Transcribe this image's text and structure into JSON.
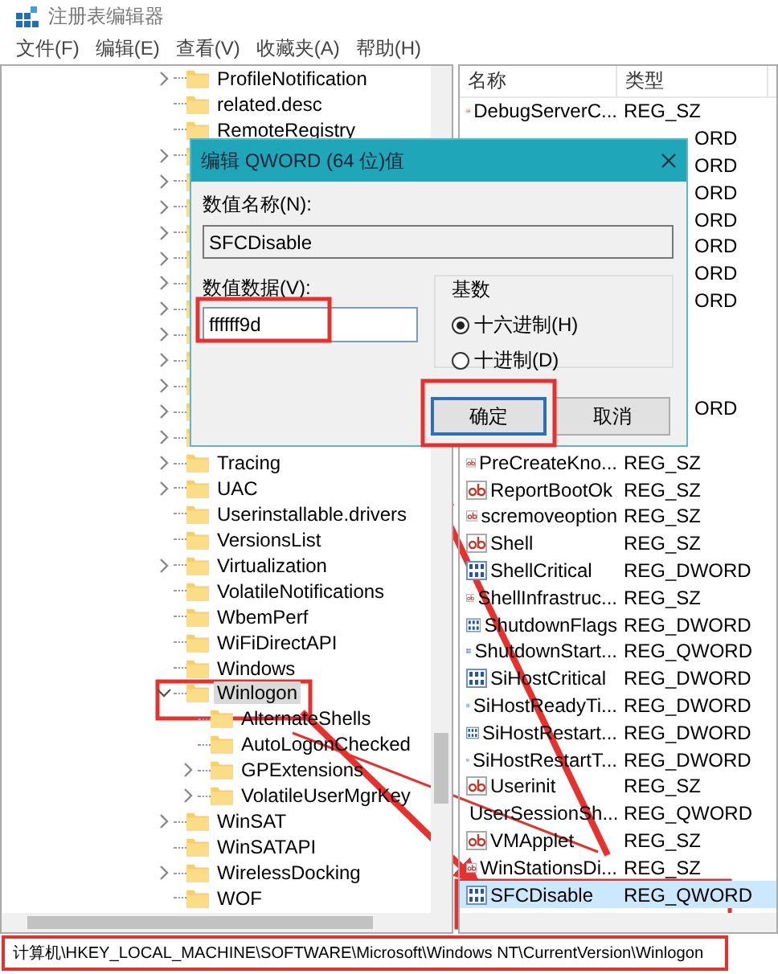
{
  "window": {
    "title": "注册表编辑器"
  },
  "menu": [
    "文件(F)",
    "编辑(E)",
    "查看(V)",
    "收藏夹(A)",
    "帮助(H)"
  ],
  "tree": [
    {
      "label": "ProfileNotification",
      "kind": "branch",
      "selected": false
    },
    {
      "label": "related.desc",
      "kind": "leaf",
      "selected": false
    },
    {
      "label": "RemoteRegistry",
      "kind": "leaf",
      "selected": false
    },
    {
      "kind": "branch"
    },
    {
      "kind": "branch"
    },
    {
      "kind": "branch"
    },
    {
      "kind": "branch"
    },
    {
      "kind": "branch"
    },
    {
      "kind": "branch"
    },
    {
      "kind": "branch"
    },
    {
      "kind": "branch"
    },
    {
      "kind": "branch"
    },
    {
      "kind": "branch"
    },
    {
      "kind": "branch"
    },
    {
      "kind": "branch"
    },
    {
      "label": "Tracing",
      "kind": "branch",
      "selected": false
    },
    {
      "label": "UAC",
      "kind": "branch",
      "selected": false
    },
    {
      "label": "Userinstallable.drivers",
      "kind": "leaf",
      "selected": false
    },
    {
      "label": "VersionsList",
      "kind": "leaf",
      "selected": false
    },
    {
      "label": "Virtualization",
      "kind": "branch",
      "selected": false
    },
    {
      "label": "VolatileNotifications",
      "kind": "leaf",
      "selected": false
    },
    {
      "label": "WbemPerf",
      "kind": "leaf",
      "selected": false
    },
    {
      "label": "WiFiDirectAPI",
      "kind": "leaf",
      "selected": false
    },
    {
      "label": "Windows",
      "kind": "leaf",
      "selected": false
    },
    {
      "label": "Winlogon",
      "kind": "open",
      "selected": true,
      "children": [
        {
          "label": "AlternateShells",
          "kind": "leaf",
          "selected": false
        },
        {
          "label": "AutoLogonChecked",
          "kind": "leaf",
          "selected": false
        },
        {
          "label": "GPExtensions",
          "kind": "branch",
          "selected": false
        },
        {
          "label": "VolatileUserMgrKey",
          "kind": "branch",
          "selected": false
        }
      ]
    },
    {
      "label": "WinSAT",
      "kind": "branch",
      "selected": false
    },
    {
      "label": "WinSATAPI",
      "kind": "leaf",
      "selected": false
    },
    {
      "label": "WirelessDocking",
      "kind": "branch",
      "selected": false
    },
    {
      "label": "WOF",
      "kind": "leaf",
      "selected": false
    }
  ],
  "list": {
    "columns": [
      "名称",
      "类型"
    ],
    "rows": [
      {
        "kind": "string",
        "name": "DebugServerC...",
        "type": "REG_SZ",
        "selected": false
      },
      {
        "kind": "covered",
        "type": "ORD"
      },
      {
        "kind": "covered",
        "type": "ORD"
      },
      {
        "kind": "covered",
        "type": "ORD"
      },
      {
        "kind": "covered",
        "type": "ORD"
      },
      {
        "kind": "covered",
        "type": "ORD"
      },
      {
        "kind": "covered",
        "type": "ORD"
      },
      {
        "kind": "covered",
        "type": "ORD"
      },
      {
        "kind": "covered"
      },
      {
        "kind": "covered"
      },
      {
        "kind": "covered"
      },
      {
        "kind": "covered",
        "type": "ORD"
      },
      {
        "kind": "covered"
      },
      {
        "kind": "string",
        "name": "PreCreateKno...",
        "type": "REG_SZ",
        "selected": false
      },
      {
        "kind": "string",
        "name": "ReportBootOk",
        "type": "REG_SZ",
        "selected": false
      },
      {
        "kind": "string",
        "name": "scremoveoption",
        "type": "REG_SZ",
        "selected": false
      },
      {
        "kind": "string",
        "name": "Shell",
        "type": "REG_SZ",
        "selected": false
      },
      {
        "kind": "binary",
        "name": "ShellCritical",
        "type": "REG_DWORD",
        "selected": false
      },
      {
        "kind": "string",
        "name": "ShellInfrastruc...",
        "type": "REG_SZ",
        "selected": false
      },
      {
        "kind": "binary",
        "name": "ShutdownFlags",
        "type": "REG_DWORD",
        "selected": false
      },
      {
        "kind": "binary",
        "name": "ShutdownStart...",
        "type": "REG_QWORD",
        "selected": false
      },
      {
        "kind": "binary",
        "name": "SiHostCritical",
        "type": "REG_DWORD",
        "selected": false
      },
      {
        "kind": "binary",
        "name": "SiHostReadyTi...",
        "type": "REG_DWORD",
        "selected": false
      },
      {
        "kind": "binary",
        "name": "SiHostRestart...",
        "type": "REG_DWORD",
        "selected": false
      },
      {
        "kind": "binary",
        "name": "SiHostRestartT...",
        "type": "REG_DWORD",
        "selected": false
      },
      {
        "kind": "string",
        "name": "Userinit",
        "type": "REG_SZ",
        "selected": false
      },
      {
        "kind": "binary",
        "name": "UserSessionSh...",
        "type": "REG_QWORD",
        "selected": false
      },
      {
        "kind": "string",
        "name": "VMApplet",
        "type": "REG_SZ",
        "selected": false
      },
      {
        "kind": "string",
        "name": "WinStationsDi...",
        "type": "REG_SZ",
        "selected": false
      },
      {
        "kind": "binary",
        "name": "SFCDisable",
        "type": "REG_QWORD",
        "selected": true
      }
    ]
  },
  "status_bar": "计算机\\HKEY_LOCAL_MACHINE\\SOFTWARE\\Microsoft\\Windows NT\\CurrentVersion\\Winlogon",
  "dialog": {
    "title": "编辑 QWORD (64 位)值",
    "name_label": "数值名称(N):",
    "name_value": "SFCDisable",
    "data_label": "数值数据(V):",
    "data_value": "ffffff9d",
    "base_label": "基数",
    "radios": [
      {
        "label": "十六进制(H)",
        "selected": true
      },
      {
        "label": "十进制(D)",
        "selected": false
      }
    ],
    "buttons": [
      {
        "label": "确定",
        "default": true
      },
      {
        "label": "取消",
        "default": false
      }
    ]
  }
}
